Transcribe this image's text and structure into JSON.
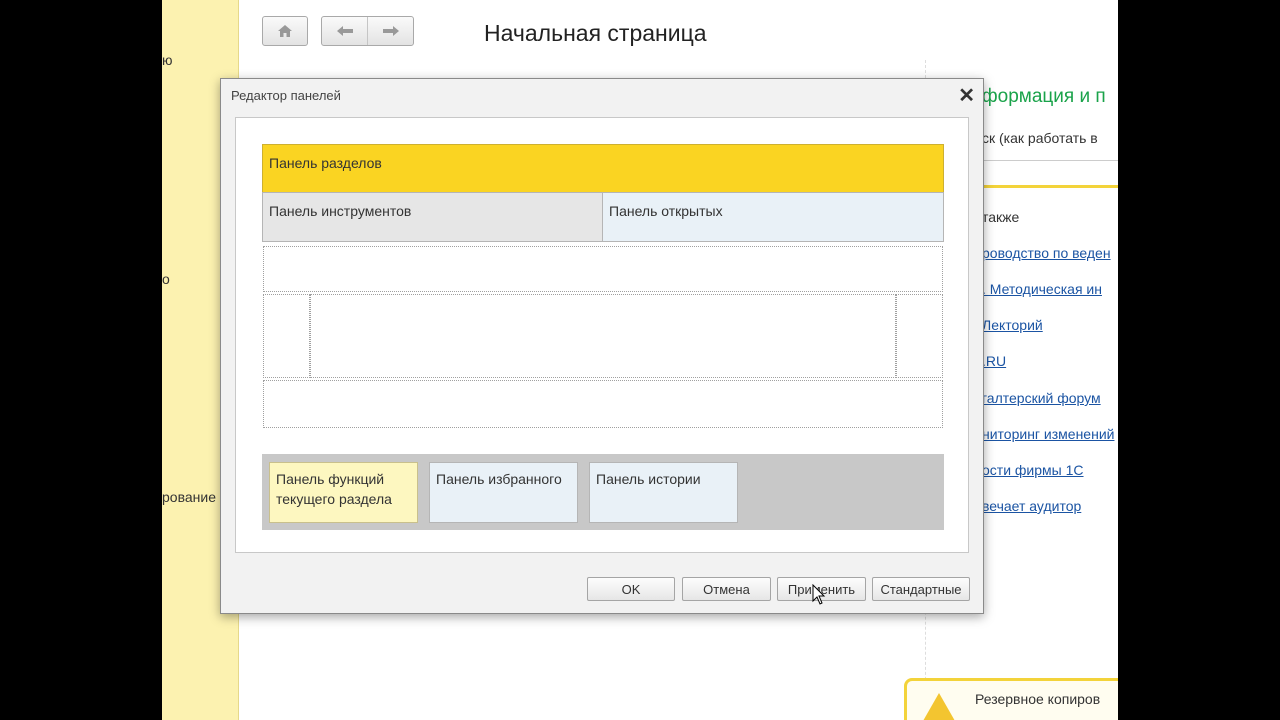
{
  "sidebar": {
    "items": [
      "ю",
      "о",
      "рование"
    ]
  },
  "nav": {
    "home_icon": "home-icon",
    "back_icon": "arrow-left-icon",
    "forward_icon": "arrow-right-icon"
  },
  "page": {
    "title": "Начальная страница"
  },
  "info_panel": {
    "title": "формация и п",
    "subtitle": "ск (как работать в",
    "see_also": "также",
    "links": [
      "роводство по веден",
      ". Методическая ин",
      "Лекторий",
      ".RU",
      "галтерский форум",
      "ниторинг изменений",
      "ости фирмы 1С",
      "вечает аудитор"
    ]
  },
  "backup": {
    "text": "Резервное копиров"
  },
  "dialog": {
    "title": "Редактор панелей",
    "panels": {
      "sections": "Панель разделов",
      "tools": "Панель инструментов",
      "open": "Панель открытых",
      "functions": "Панель функций текущего раздела",
      "favorites": "Панель избранного",
      "history": "Панель истории"
    },
    "buttons": {
      "ok": "OK",
      "cancel": "Отмена",
      "apply": "Применить",
      "default": "Стандартные"
    }
  },
  "colors": {
    "accent_yellow": "#fad422",
    "link_blue": "#1b54a3",
    "info_green": "#1aa34a"
  }
}
